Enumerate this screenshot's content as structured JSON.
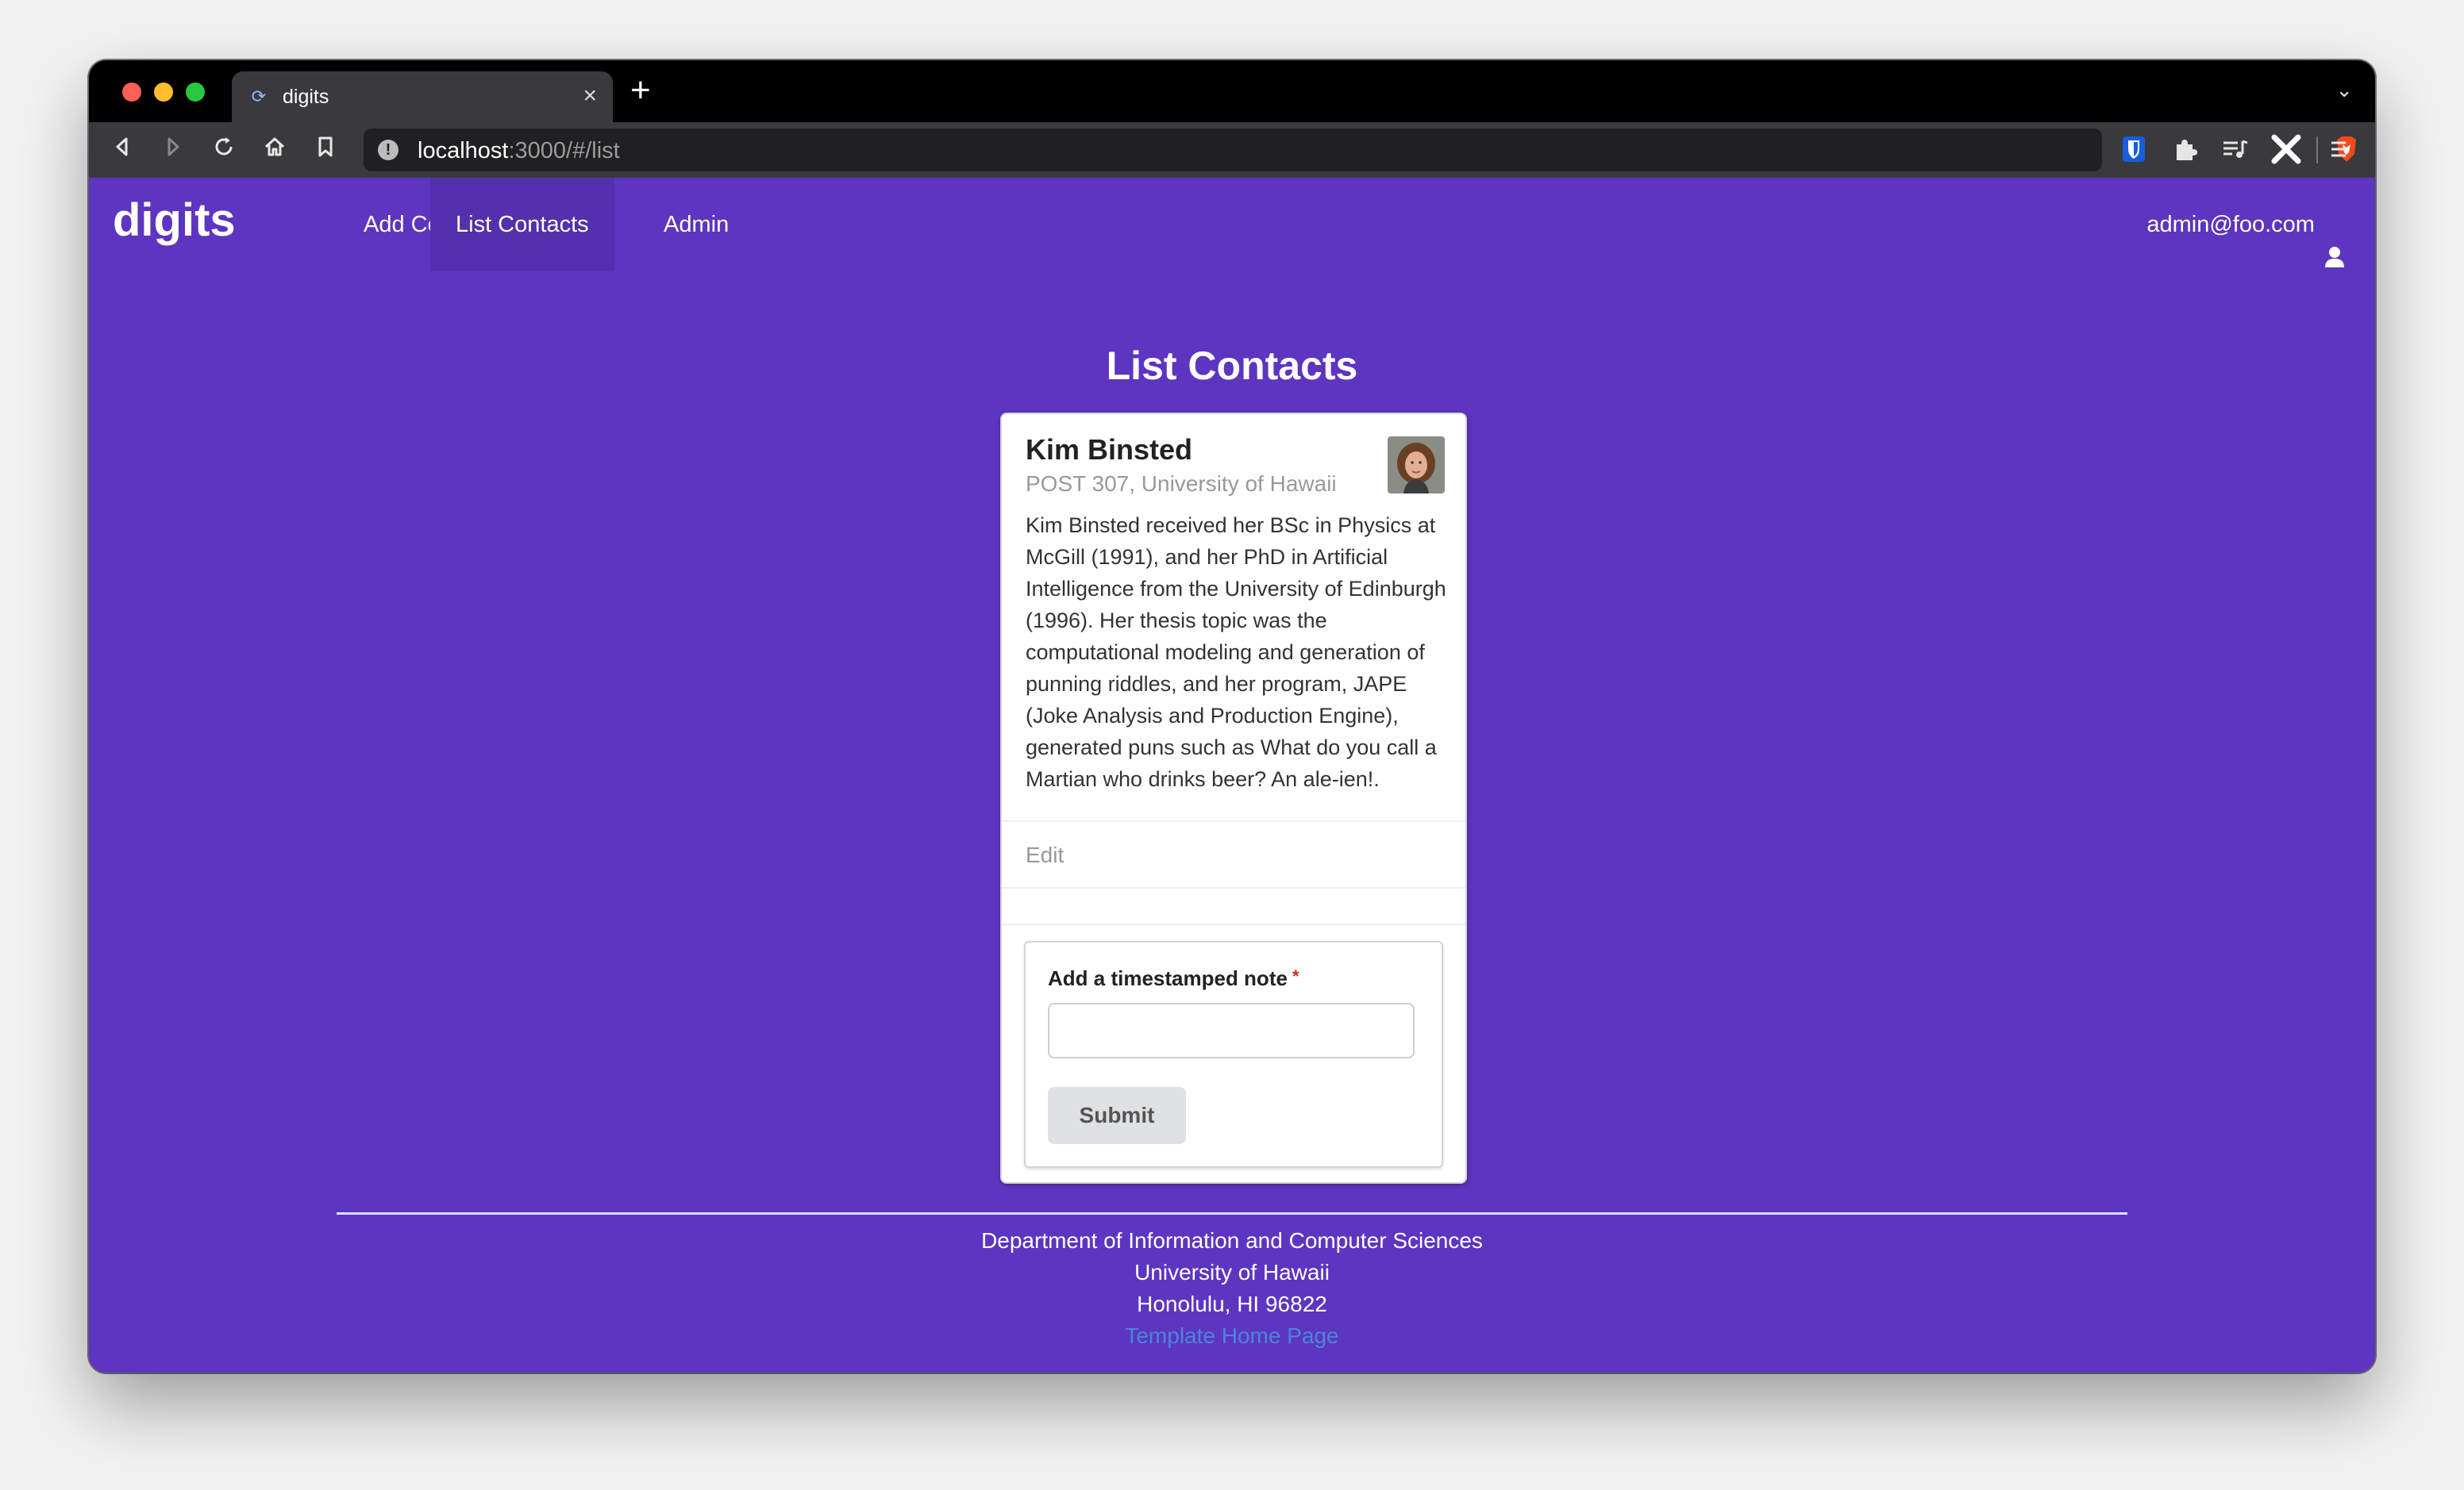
{
  "browser": {
    "tab_title": "digits",
    "new_tab_symbol": "+",
    "url_host": "localhost",
    "url_rest": ":3000/#/list",
    "icons": [
      "back-icon",
      "forward-icon",
      "reload-icon",
      "home-icon",
      "bookmark-icon",
      "info-icon",
      "brave-shields-icon",
      "bitwarden-icon",
      "extensions-icon",
      "playlist-icon",
      "sidebar-tool-icon",
      "menu-icon"
    ]
  },
  "navbar": {
    "brand": "digits",
    "items": [
      {
        "label": "Add Contacts"
      },
      {
        "label": "List Contacts",
        "active": true
      },
      {
        "label": "Admin"
      }
    ],
    "user_email": "admin@foo.com"
  },
  "page": {
    "title": "List Contacts"
  },
  "contact": {
    "name": "Kim Binsted",
    "address": "POST 307, University of Hawaii",
    "description": "Kim Binsted received her BSc in Physics at McGill (1991), and her PhD in Artificial Intelligence from the University of Edinburgh (1996). Her thesis topic was the computational modeling and generation of punning riddles, and her program, JAPE (Joke Analysis and Production Engine), generated puns such as What do you call a Martian who drinks beer? An ale-ien!.",
    "edit_label": "Edit"
  },
  "note_form": {
    "label": "Add a timestamped note",
    "required_mark": "*",
    "value": "",
    "submit_label": "Submit"
  },
  "footer": {
    "line1": "Department of Information and Computer Sciences",
    "line2": "University of Hawaii",
    "line3": "Honolulu, HI 96822",
    "link": "Template Home Page"
  },
  "colors": {
    "page_bg": "#5d35c0",
    "active_nav": "#5330ad",
    "link": "#4a86d9"
  }
}
